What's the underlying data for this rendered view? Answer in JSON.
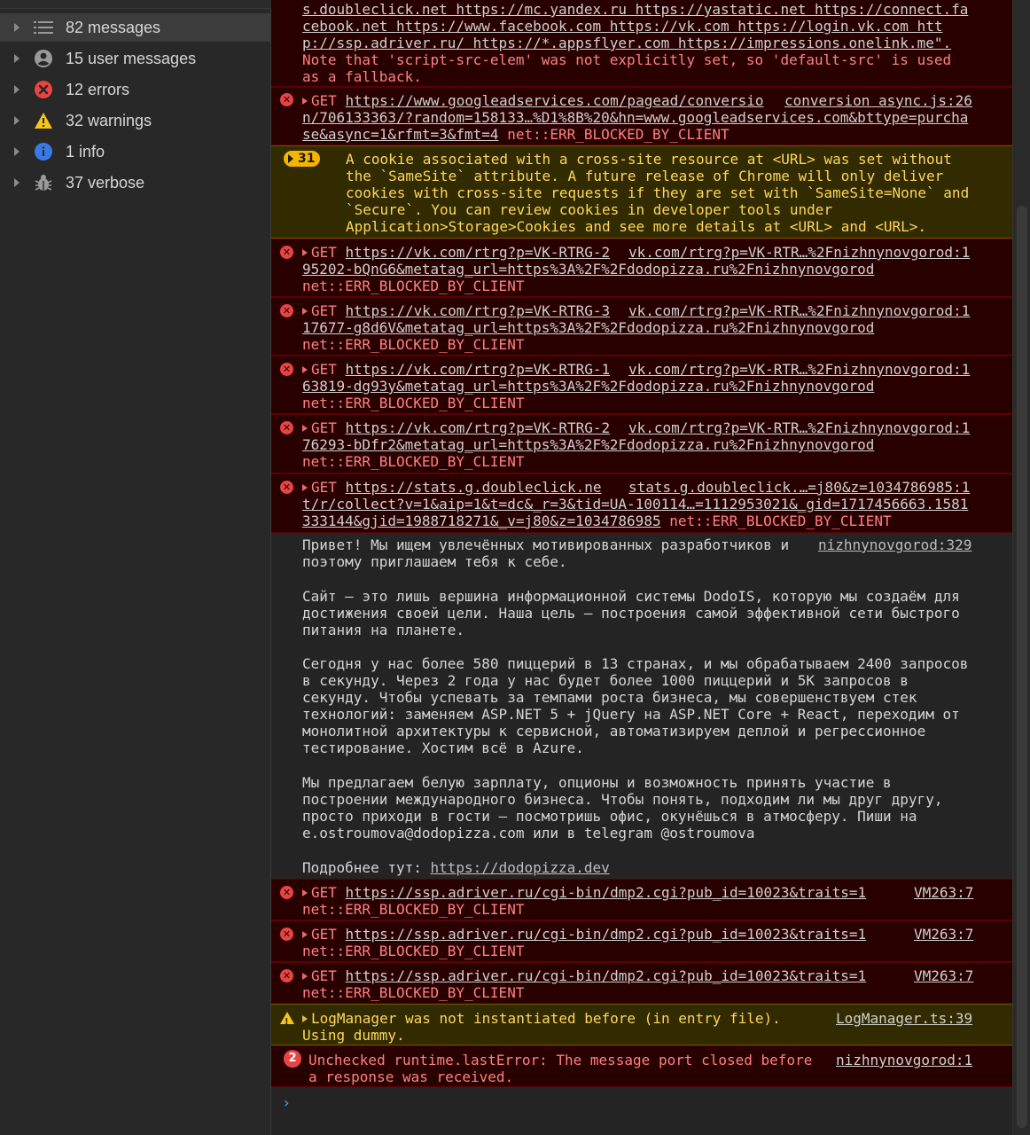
{
  "sidebar": {
    "items": [
      {
        "label": "82 messages",
        "icon": "list-icon"
      },
      {
        "label": "15 user messages",
        "icon": "user-icon"
      },
      {
        "label": "12 errors",
        "icon": "error-icon"
      },
      {
        "label": "32 warnings",
        "icon": "warning-icon"
      },
      {
        "label": "1 info",
        "icon": "info-icon"
      },
      {
        "label": "37 verbose",
        "icon": "bug-icon"
      }
    ]
  },
  "console": {
    "csp_tail": {
      "l1": "s.doubleclick.net https://mc.yandex.ru https://yastatic.net https://connect.fa",
      "l2": "cebook.net https://www.facebook.com https://vk.com https://login.vk.com htt",
      "l3": "p://ssp.adriver.ru/ https://*.appsflyer.com https://impressions.onelink.me\".",
      "l4": "Note that 'script-src-elem' was not explicitly set, so 'default-src' is used",
      "l5": "as a fallback."
    },
    "gads": {
      "method": "GET",
      "url1": "https://www.googleadservices.com/pagead/conversio",
      "src": "conversion async.js:26",
      "l2": "n/706133363/?random=158133…%D1%8B%20&hn=www.googleadservices.com&bttype=purcha",
      "l3": "se&async=1&rfmt=3&fmt=4",
      "err": "net::ERR_BLOCKED_BY_CLIENT"
    },
    "cookie_warning": {
      "count": "31",
      "l1": "A cookie associated with a cross-site resource at <URL> was set without",
      "l2": "the `SameSite` attribute. A future release of Chrome will only deliver",
      "l3": "cookies with cross-site requests if they are set with `SameSite=None` and",
      "l4": "`Secure`. You can review cookies in developer tools under",
      "l5": "Application>Storage>Cookies and see more details at <URL> and <URL>."
    },
    "vk": [
      {
        "method": "GET",
        "url": "https://vk.com/rtrg?p=VK-RTRG-2",
        "src": "vk.com/rtrg?p=VK-RTR…%2Fnizhnynovgorod:1",
        "l2": "95202-bQnG6&metatag_url=https%3A%2F%2Fdodopizza.ru%2Fnizhnynovgorod",
        "err": "net::ERR_BLOCKED_BY_CLIENT"
      },
      {
        "method": "GET",
        "url": "https://vk.com/rtrg?p=VK-RTRG-3",
        "src": "vk.com/rtrg?p=VK-RTR…%2Fnizhnynovgorod:1",
        "l2": "17677-g8d6V&metatag_url=https%3A%2F%2Fdodopizza.ru%2Fnizhnynovgorod",
        "err": "net::ERR_BLOCKED_BY_CLIENT"
      },
      {
        "method": "GET",
        "url": "https://vk.com/rtrg?p=VK-RTRG-1",
        "src": "vk.com/rtrg?p=VK-RTR…%2Fnizhnynovgorod:1",
        "l2": "63819-dg93y&metatag_url=https%3A%2F%2Fdodopizza.ru%2Fnizhnynovgorod",
        "err": "net::ERR_BLOCKED_BY_CLIENT"
      },
      {
        "method": "GET",
        "url": "https://vk.com/rtrg?p=VK-RTRG-2",
        "src": "vk.com/rtrg?p=VK-RTR…%2Fnizhnynovgorod:1",
        "l2": "76293-bDfr2&metatag_url=https%3A%2F%2Fdodopizza.ru%2Fnizhnynovgorod",
        "err": "net::ERR_BLOCKED_BY_CLIENT"
      }
    ],
    "dclick": {
      "method": "GET",
      "url": "https://stats.g.doubleclick.ne",
      "src": "stats.g.doubleclick.…=j80&z=1034786985:1",
      "l2": "t/r/collect?v=1&aip=1&t=dc&_r=3&tid=UA-100114…=1112953021&_gid=1717456663.1581",
      "l3": "333144&gjid=1988718271&_v=j80&z=1034786985",
      "err": "net::ERR_BLOCKED_BY_CLIENT"
    },
    "hiring": {
      "src": "nizhnynovgorod:329",
      "p1a": "Привет! Мы ищем увлечённых мотивированных разработчиков и",
      "p1b": "поэтому приглашаем тебя к себе.",
      "p2a": "Сайт — это лишь вершина информационной системы DodoIS, которую мы создаём для",
      "p2b": "достижения своей цели. Наша цель — построения самой эффективной сети быстрого",
      "p2c": "питания на планете.",
      "p3a": "Сегодня у нас более 580 пиццерий в 13 странах, и мы обрабатываем 2400 запросов",
      "p3b": "в секунду. Через 2 года у нас будет более 1000 пиццерий и 5К запросов в",
      "p3c": "секунду. Чтобы успевать за темпами роста бизнеса, мы совершенствуем стек",
      "p3d": "технологий: заменяем ASP.NET 5 + jQuery на ASP.NET Core + React, переходим от",
      "p3e": "монолитной архитектуры к сервисной, автоматизируем деплой и регрессионное",
      "p3f": "тестирование. Хостим всё в Azure.",
      "p4a": "Мы предлагаем белую зарплату, опционы и возможность принять участие в",
      "p4b": "построении международного бизнеса. Чтобы понять, подходим ли мы друг другу,",
      "p4c": "просто приходи в гости — посмотришь офис, окунёшься в атмосферу. Пиши на",
      "p4d": "e.ostroumova@dodopizza.com или в telegram @ostroumova",
      "more_label": "Подробнее тут: ",
      "more_link": "https://dodopizza.dev"
    },
    "adriver": [
      {
        "method": "GET",
        "url": "https://ssp.adriver.ru/cgi-bin/dmp2.cgi?pub_id=10023&traits=1",
        "src": "VM263:7",
        "err": "net::ERR_BLOCKED_BY_CLIENT"
      },
      {
        "method": "GET",
        "url": "https://ssp.adriver.ru/cgi-bin/dmp2.cgi?pub_id=10023&traits=1",
        "src": "VM263:7",
        "err": "net::ERR_BLOCKED_BY_CLIENT"
      },
      {
        "method": "GET",
        "url": "https://ssp.adriver.ru/cgi-bin/dmp2.cgi?pub_id=10023&traits=1",
        "src": "VM263:7",
        "err": "net::ERR_BLOCKED_BY_CLIENT"
      }
    ],
    "logmanager": {
      "l1": "LogManager was not instantiated before (in entry file).",
      "l2": "Using dummy.",
      "src": "LogManager.ts:39"
    },
    "lasterror": {
      "count": "2",
      "l1": "Unchecked runtime.lastError: The message port closed before",
      "l2": "a response was received.",
      "src": "nizhnynovgorod:1"
    },
    "prompt": "›"
  },
  "colors": {
    "error_bg": "#290000",
    "error_text": "#ff8080",
    "warn_bg": "#332b00",
    "warn_text": "#fdd75c",
    "log_text": "#d5d5d5",
    "prompt": "#4fa3ff"
  }
}
